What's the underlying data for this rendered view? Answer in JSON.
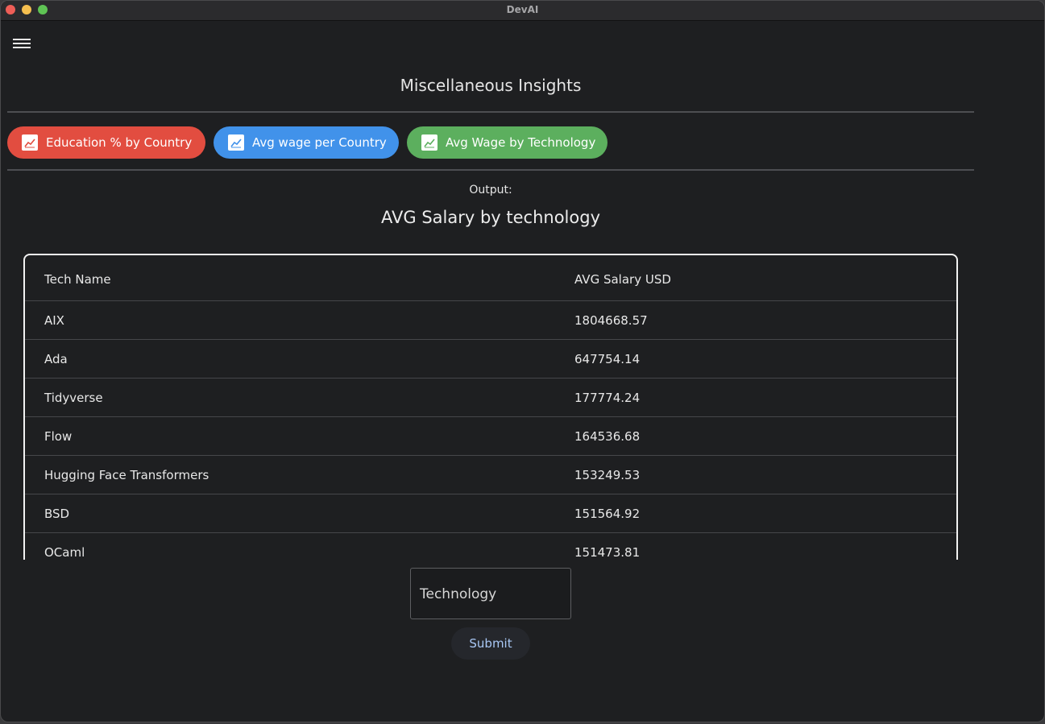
{
  "window": {
    "title": "DevAI"
  },
  "header": {
    "title": "Miscellaneous Insights"
  },
  "buttons": [
    {
      "label": "Education % by Country",
      "color": "#e24d40",
      "icon": "chart-line-icon"
    },
    {
      "label": "Avg wage per Country",
      "color": "#4192ea",
      "icon": "chart-line-icon"
    },
    {
      "label": "Avg Wage by Technology",
      "color": "#5caf5e",
      "icon": "chart-line-icon"
    }
  ],
  "output": {
    "label": "Output:",
    "title": "AVG Salary by technology"
  },
  "table": {
    "headers": [
      "Tech Name",
      "AVG Salary USD"
    ],
    "rows": [
      [
        "AIX",
        "1804668.57"
      ],
      [
        "Ada",
        "647754.14"
      ],
      [
        "Tidyverse",
        "177774.24"
      ],
      [
        "Flow",
        "164536.68"
      ],
      [
        "Hugging Face Transformers",
        "153249.53"
      ],
      [
        "BSD",
        "151564.92"
      ],
      [
        "OCaml",
        "151473.81"
      ]
    ]
  },
  "form": {
    "input_value": "Technology",
    "submit_label": "Submit"
  }
}
